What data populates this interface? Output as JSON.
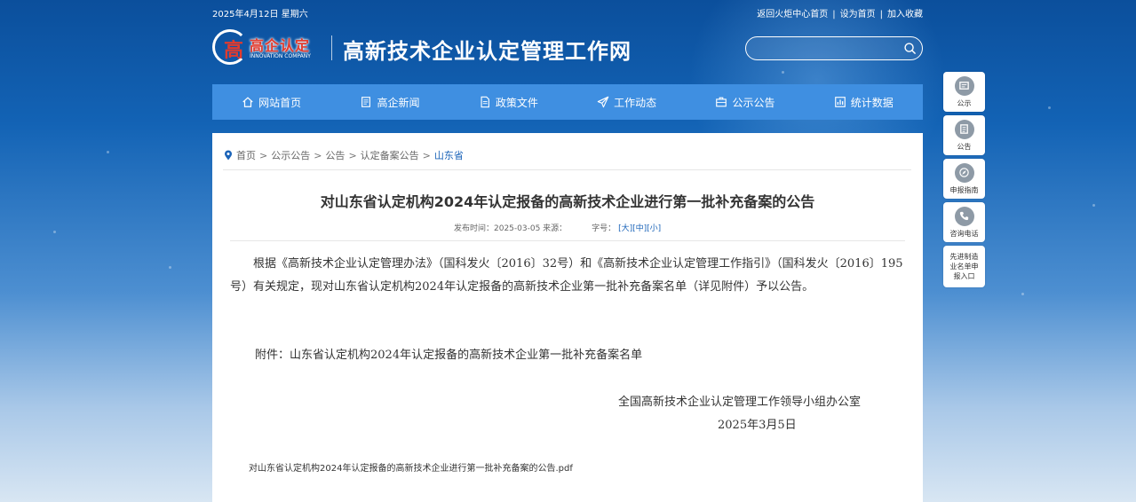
{
  "topbar": {
    "date": "2025年4月12日 星期六",
    "links": [
      "返回火炬中心首页",
      "设为首页",
      "加入收藏"
    ],
    "separator": "|"
  },
  "logo": {
    "glyph": "高",
    "cn": "高企认定",
    "en": "INNOVATION COMPANY"
  },
  "site_title": "高新技术企业认定管理工作网",
  "search": {
    "placeholder": ""
  },
  "nav": [
    {
      "label": "网站首页",
      "icon": "home-icon"
    },
    {
      "label": "高企新闻",
      "icon": "news-icon"
    },
    {
      "label": "政策文件",
      "icon": "document-icon"
    },
    {
      "label": "工作动态",
      "icon": "send-icon"
    },
    {
      "label": "公示公告",
      "icon": "briefcase-icon"
    },
    {
      "label": "统计数据",
      "icon": "chart-icon"
    }
  ],
  "breadcrumb": [
    "首页",
    "公示公告",
    "公告",
    "认定备案公告",
    "山东省"
  ],
  "breadcrumb_sep": ">",
  "article": {
    "title": "对山东省认定机构2024年认定报备的高新技术企业进行第一批补充备案的公告",
    "meta_published": "发布时间：2025-03-05 来源：",
    "meta_fontsize_label": "字号：",
    "font_sizes": [
      "[大]",
      "[中]",
      "[小]"
    ],
    "body": "根据《高新技术企业认定管理办法》（国科发火〔2016〕32号）和《高新技术企业认定管理工作指引》（国科发火〔2016〕195号）有关规定，现对山东省认定机构2024年认定报备的高新技术企业第一批补充备案名单（详见附件）予以公告。",
    "attachment": "附件：山东省认定机构2024年认定报备的高新技术企业第一批补充备案名单",
    "signature_org": "全国高新技术企业认定管理工作领导小组办公室",
    "signature_date": "2025年3月5日",
    "pdf": "对山东省认定机构2024年认定报备的高新技术企业进行第一批补充备案的公告.pdf"
  },
  "side": [
    {
      "label": "公示",
      "icon": "notice-board-icon"
    },
    {
      "label": "公告",
      "icon": "announcement-icon"
    },
    {
      "label": "申报指南",
      "icon": "compass-icon"
    },
    {
      "label": "咨询电话",
      "icon": "phone-icon"
    },
    {
      "label": "先进制造业名单申报入口"
    }
  ]
}
